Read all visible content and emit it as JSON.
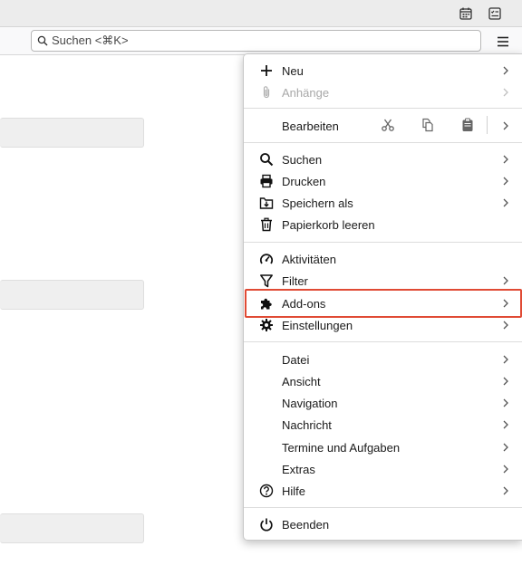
{
  "search": {
    "placeholder": "Suchen <⌘K>"
  },
  "titlebar": {
    "icons": [
      "calendar-icon",
      "tasks-icon"
    ]
  },
  "menu": {
    "items": [
      {
        "label": "Neu",
        "icon": "plus-icon",
        "submenu": true
      },
      {
        "label": "Anhänge",
        "icon": "paperclip-icon",
        "submenu": true,
        "disabled": true
      },
      {
        "label": "Bearbeiten",
        "actions": [
          "cut-icon",
          "copy-icon",
          "paste-icon"
        ],
        "submenu": true
      },
      {
        "label": "Suchen",
        "icon": "search-icon",
        "submenu": true
      },
      {
        "label": "Drucken",
        "icon": "printer-icon",
        "submenu": true
      },
      {
        "label": "Speichern als",
        "icon": "save-icon",
        "submenu": true
      },
      {
        "label": "Papierkorb leeren",
        "icon": "trash-icon",
        "submenu": false
      },
      {
        "label": "Aktivitäten",
        "icon": "activity-gauge-icon",
        "submenu": false
      },
      {
        "label": "Filter",
        "icon": "filter-icon",
        "submenu": true
      },
      {
        "label": "Add-ons",
        "icon": "puzzle-icon",
        "submenu": true,
        "highlighted": true
      },
      {
        "label": "Einstellungen",
        "icon": "gear-icon",
        "submenu": true
      },
      {
        "label": "Datei",
        "submenu": true
      },
      {
        "label": "Ansicht",
        "submenu": true
      },
      {
        "label": "Navigation",
        "submenu": true
      },
      {
        "label": "Nachricht",
        "submenu": true
      },
      {
        "label": "Termine und Aufgaben",
        "submenu": true
      },
      {
        "label": "Extras",
        "submenu": true
      },
      {
        "label": "Hilfe",
        "icon": "help-icon",
        "submenu": true
      },
      {
        "label": "Beenden",
        "icon": "power-icon",
        "submenu": false
      }
    ]
  },
  "colors": {
    "highlight_border": "#e04a34",
    "menu_bg": "#ffffff",
    "toolbar_bg": "#f9f9fa"
  }
}
